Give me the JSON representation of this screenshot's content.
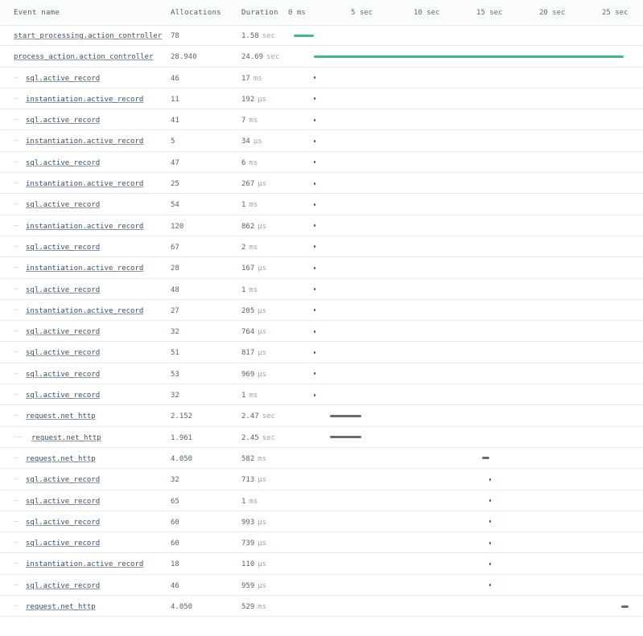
{
  "header": {
    "event_name": "Event name",
    "allocations": "Allocations",
    "duration": "Duration",
    "ticks": [
      "0 ms",
      "5 sec",
      "10 sec",
      "15 sec",
      "20 sec",
      "25 sec"
    ]
  },
  "colors": {
    "primary_bar": "#3fb88f",
    "io_bar": "#6b6b6b",
    "tiny_bar": "#2b5f7e"
  },
  "rows": [
    {
      "name": "start_processing.action_controller",
      "allocations": "78",
      "duration": "1.58",
      "unit": "sec",
      "depth": 0,
      "bar": "primary",
      "start_s": 0.2,
      "length_s": 1.58
    },
    {
      "name": "process_action.action_controller",
      "allocations": "28.940",
      "duration": "24.69",
      "unit": "sec",
      "depth": 0,
      "bar": "primary",
      "start_s": 1.8,
      "length_s": 24.69
    },
    {
      "name": "sql.active_record",
      "allocations": "46",
      "duration": "17",
      "unit": "ms",
      "depth": 1,
      "bar": "tiny",
      "start_s": 1.8,
      "length_s": 0.017
    },
    {
      "name": "instantiation.active_record",
      "allocations": "11",
      "duration": "192",
      "unit": "μs",
      "depth": 1,
      "bar": "tiny",
      "start_s": 1.8,
      "length_s": 0.0002
    },
    {
      "name": "sql.active_record",
      "allocations": "41",
      "duration": "7",
      "unit": "ms",
      "depth": 1,
      "bar": "tiny",
      "start_s": 1.8,
      "length_s": 0.007
    },
    {
      "name": "instantiation.active_record",
      "allocations": "5",
      "duration": "34",
      "unit": "μs",
      "depth": 1,
      "bar": "tiny",
      "start_s": 1.8,
      "length_s": 3e-05
    },
    {
      "name": "sql.active_record",
      "allocations": "47",
      "duration": "6",
      "unit": "ms",
      "depth": 1,
      "bar": "tiny",
      "start_s": 1.8,
      "length_s": 0.006
    },
    {
      "name": "instantiation.active_record",
      "allocations": "25",
      "duration": "267",
      "unit": "μs",
      "depth": 1,
      "bar": "tiny",
      "start_s": 1.8,
      "length_s": 0.0003
    },
    {
      "name": "sql.active_record",
      "allocations": "54",
      "duration": "1",
      "unit": "ms",
      "depth": 1,
      "bar": "tiny",
      "start_s": 1.8,
      "length_s": 0.001
    },
    {
      "name": "instantiation.active_record",
      "allocations": "120",
      "duration": "862",
      "unit": "μs",
      "depth": 1,
      "bar": "tiny",
      "start_s": 1.8,
      "length_s": 0.0009
    },
    {
      "name": "sql.active_record",
      "allocations": "67",
      "duration": "2",
      "unit": "ms",
      "depth": 1,
      "bar": "tiny",
      "start_s": 1.8,
      "length_s": 0.002
    },
    {
      "name": "instantiation.active_record",
      "allocations": "28",
      "duration": "167",
      "unit": "μs",
      "depth": 1,
      "bar": "tiny",
      "start_s": 1.8,
      "length_s": 0.0002
    },
    {
      "name": "sql.active_record",
      "allocations": "48",
      "duration": "1",
      "unit": "ms",
      "depth": 1,
      "bar": "tiny",
      "start_s": 1.8,
      "length_s": 0.001
    },
    {
      "name": "instantiation.active_record",
      "allocations": "27",
      "duration": "205",
      "unit": "μs",
      "depth": 1,
      "bar": "tiny",
      "start_s": 1.8,
      "length_s": 0.0002
    },
    {
      "name": "sql.active_record",
      "allocations": "32",
      "duration": "764",
      "unit": "μs",
      "depth": 1,
      "bar": "tiny",
      "start_s": 1.8,
      "length_s": 0.0008
    },
    {
      "name": "sql.active_record",
      "allocations": "51",
      "duration": "817",
      "unit": "μs",
      "depth": 1,
      "bar": "tiny",
      "start_s": 1.8,
      "length_s": 0.0008
    },
    {
      "name": "sql.active_record",
      "allocations": "53",
      "duration": "969",
      "unit": "μs",
      "depth": 1,
      "bar": "tiny",
      "start_s": 1.8,
      "length_s": 0.001
    },
    {
      "name": "sql.active_record",
      "allocations": "32",
      "duration": "1",
      "unit": "ms",
      "depth": 1,
      "bar": "tiny",
      "start_s": 1.8,
      "length_s": 0.001
    },
    {
      "name": "request.net_http",
      "allocations": "2.152",
      "duration": "2.47",
      "unit": "sec",
      "depth": 1,
      "bar": "io",
      "start_s": 3.1,
      "length_s": 2.47
    },
    {
      "name": "request.net_http",
      "allocations": "1.961",
      "duration": "2.45",
      "unit": "sec",
      "depth": 2,
      "bar": "io",
      "start_s": 3.1,
      "length_s": 2.45
    },
    {
      "name": "request.net_http",
      "allocations": "4.050",
      "duration": "582",
      "unit": "ms",
      "depth": 1,
      "bar": "io",
      "start_s": 15.2,
      "length_s": 0.582
    },
    {
      "name": "sql.active_record",
      "allocations": "32",
      "duration": "713",
      "unit": "μs",
      "depth": 1,
      "bar": "tiny",
      "start_s": 15.8,
      "length_s": 0.0007
    },
    {
      "name": "sql.active_record",
      "allocations": "65",
      "duration": "1",
      "unit": "ms",
      "depth": 1,
      "bar": "tiny",
      "start_s": 15.8,
      "length_s": 0.001
    },
    {
      "name": "sql.active_record",
      "allocations": "60",
      "duration": "993",
      "unit": "μs",
      "depth": 1,
      "bar": "tiny",
      "start_s": 15.8,
      "length_s": 0.001
    },
    {
      "name": "sql.active_record",
      "allocations": "60",
      "duration": "739",
      "unit": "μs",
      "depth": 1,
      "bar": "tiny",
      "start_s": 15.8,
      "length_s": 0.0007
    },
    {
      "name": "instantiation.active_record",
      "allocations": "18",
      "duration": "110",
      "unit": "μs",
      "depth": 1,
      "bar": "tiny",
      "start_s": 15.8,
      "length_s": 0.0001
    },
    {
      "name": "sql.active_record",
      "allocations": "46",
      "duration": "959",
      "unit": "μs",
      "depth": 1,
      "bar": "tiny",
      "start_s": 15.8,
      "length_s": 0.001
    },
    {
      "name": "request.net_http",
      "allocations": "4.050",
      "duration": "529",
      "unit": "ms",
      "depth": 1,
      "bar": "io",
      "start_s": 26.3,
      "length_s": 0.529
    }
  ]
}
